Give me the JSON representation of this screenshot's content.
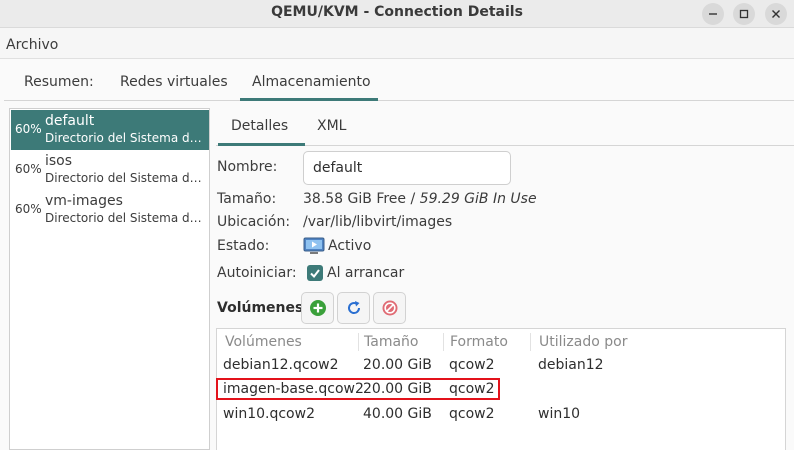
{
  "window": {
    "title": "QEMU/KVM - Connection Details"
  },
  "menu": {
    "file": "Archivo"
  },
  "tabs": [
    {
      "label": "Resumen:"
    },
    {
      "label": "Redes virtuales"
    },
    {
      "label": "Almacenamiento"
    }
  ],
  "pools": [
    {
      "pct": "60%",
      "name": "default",
      "desc": "Directorio del Sistema de Archivos"
    },
    {
      "pct": "60%",
      "name": "isos",
      "desc": "Directorio del Sistema de Archivos"
    },
    {
      "pct": "60%",
      "name": "vm-images",
      "desc": "Directorio del Sistema de Archivos"
    }
  ],
  "subtabs": {
    "details": "Detalles",
    "xml": "XML"
  },
  "details": {
    "name_label": "Nombre:",
    "name_value": "default",
    "size_label": "Tamaño:",
    "size_free": "38.58 GiB Free /",
    "size_use": "59.29 GiB In Use",
    "location_label": "Ubicación:",
    "location_value": "/var/lib/libvirt/images",
    "state_label": "Estado:",
    "state_value": "Activo",
    "autostart_label": "Autoiniciar:",
    "autostart_value": "Al arrancar",
    "autostart_checked": true
  },
  "volumes": {
    "label": "Volúmenes",
    "columns": [
      "Volúmenes",
      "Tamaño",
      "Formato",
      "Utilizado por"
    ],
    "rows": [
      {
        "name": "debian12.qcow2",
        "size": "20.00 GiB",
        "format": "qcow2",
        "used_by": "debian12"
      },
      {
        "name": "imagen-base.qcow2",
        "size": "20.00 GiB",
        "format": "qcow2",
        "used_by": ""
      },
      {
        "name": "win10.qcow2",
        "size": "40.00 GiB",
        "format": "qcow2",
        "used_by": "win10"
      }
    ]
  },
  "colors": {
    "accent": "#3d7a78",
    "highlight": "#e3121b",
    "add_green": "#3aa03a",
    "refresh_blue": "#2a6fd1",
    "delete_red": "#e06b74"
  },
  "icons": {
    "minimize": "minimize-icon",
    "maximize": "maximize-icon",
    "close": "close-icon",
    "state": "monitor-play-icon",
    "add": "add-icon",
    "refresh": "refresh-icon",
    "delete": "delete-icon"
  }
}
